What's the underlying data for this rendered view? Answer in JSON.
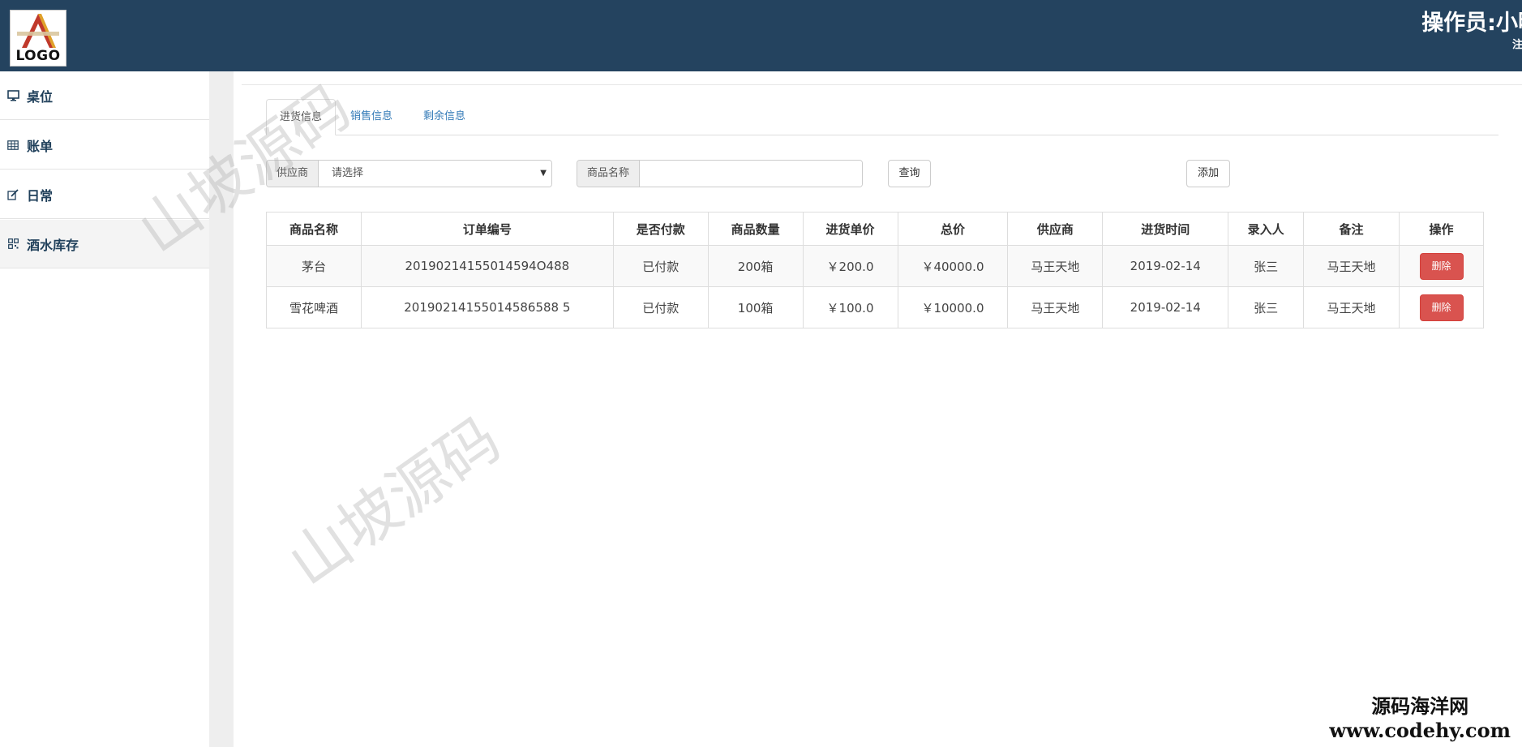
{
  "header": {
    "logo_text": "LOGO",
    "operator": "操作员:小明",
    "logout": "注销",
    "bg_color": "#24435f"
  },
  "sidebar": {
    "items": [
      {
        "label": "桌位",
        "icon": "monitor-icon"
      },
      {
        "label": "账单",
        "icon": "table-icon"
      },
      {
        "label": "日常",
        "icon": "edit-icon"
      },
      {
        "label": "酒水库存",
        "icon": "qrcode-icon",
        "active": true
      }
    ]
  },
  "tabs": [
    {
      "label": "进货信息",
      "active": true
    },
    {
      "label": "销售信息"
    },
    {
      "label": "剩余信息"
    }
  ],
  "filters": {
    "supplier_label": "供应商",
    "supplier_value": "请选择",
    "product_label": "商品名称",
    "product_value": "",
    "query_button": "查询",
    "add_button": "添加"
  },
  "table": {
    "headers": [
      "商品名称",
      "订单编号",
      "是否付款",
      "商品数量",
      "进货单价",
      "总价",
      "供应商",
      "进货时间",
      "录入人",
      "备注",
      "操作"
    ],
    "rows": [
      {
        "name": "茅台",
        "order_no": "20190214155014594O488",
        "paid": "已付款",
        "qty": "200箱",
        "unit_price": "￥200.0",
        "total": "￥40000.0",
        "supplier": "马王天地",
        "date": "2019-02-14",
        "operator": "张三",
        "note": "马王天地",
        "action": "删除"
      },
      {
        "name": "雪花啤酒",
        "order_no": "20190214155014586588 5",
        "paid": "已付款",
        "qty": "100箱",
        "unit_price": "￥100.0",
        "total": "￥10000.0",
        "supplier": "马王天地",
        "date": "2019-02-14",
        "operator": "张三",
        "note": "马王天地",
        "action": "删除"
      }
    ]
  },
  "watermarks": {
    "text": "山坡源码"
  },
  "footer_mark": {
    "cn": "源码海洋网",
    "url": "www.codehy.com"
  },
  "colors": {
    "danger": "#d9534f",
    "link": "#337ab7"
  }
}
